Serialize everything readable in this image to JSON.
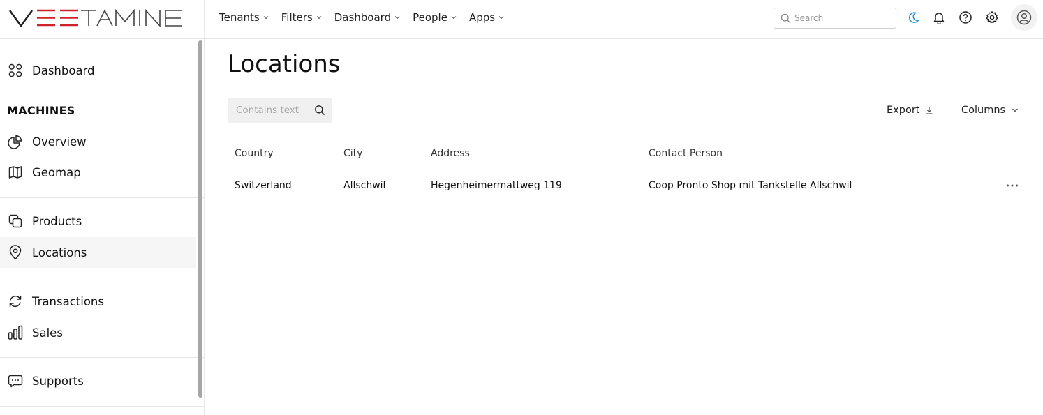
{
  "brand": {
    "logo_text": "VEETAMINE",
    "accent": "#d0202a"
  },
  "topnav": {
    "items": [
      {
        "label": "Tenants"
      },
      {
        "label": "Filters"
      },
      {
        "label": "Dashboard"
      },
      {
        "label": "People"
      },
      {
        "label": "Apps"
      }
    ],
    "search_placeholder": "Search",
    "icons": [
      "moon-icon",
      "bell-icon",
      "help-icon",
      "settings-icon",
      "user-avatar-icon"
    ],
    "moon_color": "#1e8fd6"
  },
  "sidebar": {
    "dashboard": {
      "label": "Dashboard",
      "icon": "grid-icon"
    },
    "section_title": "MACHINES",
    "items": [
      {
        "label": "Overview",
        "icon": "pie-chart-icon"
      },
      {
        "label": "Geomap",
        "icon": "map-icon"
      },
      {
        "label": "Products",
        "icon": "copy-icon"
      },
      {
        "label": "Locations",
        "icon": "location-pin-icon",
        "active": true
      },
      {
        "label": "Transactions",
        "icon": "refresh-icon"
      },
      {
        "label": "Sales",
        "icon": "bar-chart-icon"
      },
      {
        "label": "Supports",
        "icon": "chat-icon"
      }
    ]
  },
  "main": {
    "title": "Locations",
    "filter_placeholder": "Contains text",
    "export_label": "Export",
    "columns_label": "Columns",
    "table": {
      "headers": [
        "Country",
        "City",
        "Address",
        "Contact Person"
      ],
      "rows": [
        [
          "Switzerland",
          "Allschwil",
          "Hegenheimermattweg 119",
          "Coop Pronto Shop mit Tankstelle Allschwil"
        ]
      ]
    }
  }
}
